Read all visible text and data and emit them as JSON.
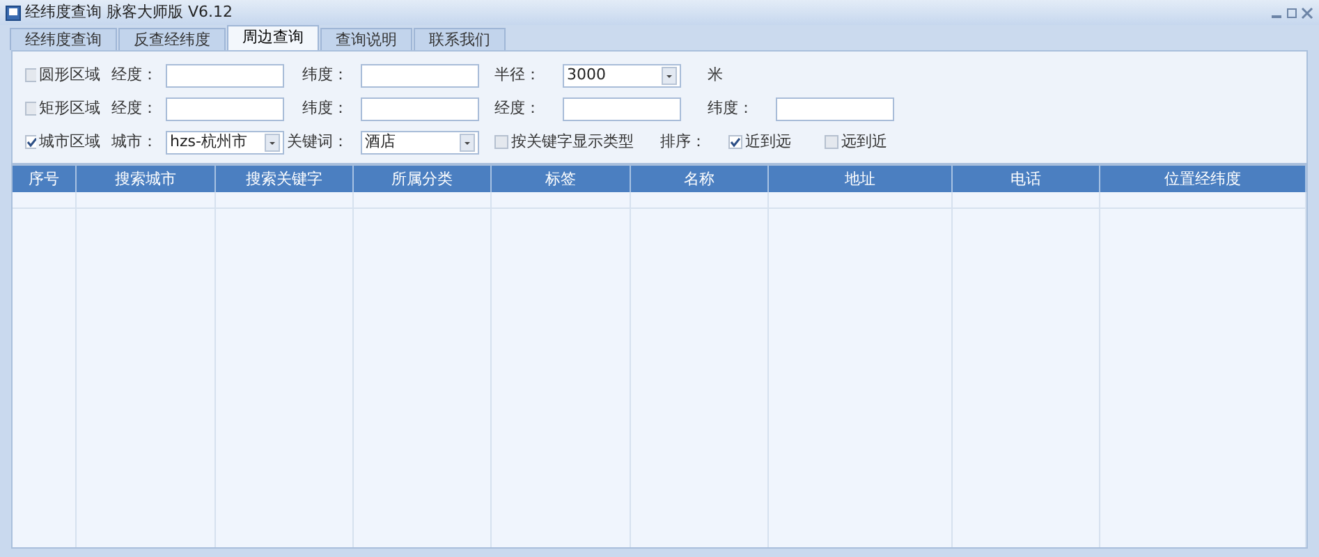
{
  "window": {
    "title": "经纬度查询 脉客大师版 V6.12"
  },
  "tabs": [
    {
      "label": "经纬度查询",
      "selected": false
    },
    {
      "label": "反查经纬度",
      "selected": false
    },
    {
      "label": "周边查询",
      "selected": true
    },
    {
      "label": "查询说明",
      "selected": false
    },
    {
      "label": "联系我们",
      "selected": false
    }
  ],
  "filter_rows": [
    {
      "items": [
        {
          "kind": "checkbox",
          "label": "圆形区域",
          "checked": false
        },
        {
          "kind": "label",
          "text": "经度："
        },
        {
          "kind": "field",
          "value": ""
        },
        {
          "kind": "label",
          "text": "纬度："
        },
        {
          "kind": "field",
          "value": ""
        },
        {
          "kind": "label",
          "text": "半径："
        },
        {
          "kind": "select",
          "value": "3000"
        },
        {
          "kind": "label",
          "text": "米"
        }
      ]
    },
    {
      "items": [
        {
          "kind": "checkbox",
          "label": "矩形区域",
          "checked": false
        },
        {
          "kind": "label",
          "text": "经度："
        },
        {
          "kind": "field",
          "value": ""
        },
        {
          "kind": "label",
          "text": "纬度："
        },
        {
          "kind": "field",
          "value": ""
        },
        {
          "kind": "label",
          "text": "经度："
        },
        {
          "kind": "field",
          "value": ""
        },
        {
          "kind": "label",
          "text": "纬度："
        },
        {
          "kind": "field",
          "value": ""
        }
      ]
    },
    {
      "items": [
        {
          "kind": "checkbox",
          "label": "城市区域",
          "checked": true
        },
        {
          "kind": "label",
          "text": "城市："
        },
        {
          "kind": "select",
          "value": "hzs-杭州市"
        },
        {
          "kind": "label",
          "text": "关键词："
        },
        {
          "kind": "select",
          "value": "酒店"
        },
        {
          "kind": "checkbox",
          "label": "按关键字显示类型",
          "checked": false
        },
        {
          "kind": "label",
          "text": "排序："
        },
        {
          "kind": "checkbox",
          "label": "近到远",
          "checked": true
        },
        {
          "kind": "checkbox",
          "label": "远到近",
          "checked": false
        }
      ]
    }
  ],
  "table": {
    "columns": [
      "序号",
      "搜索城市",
      "搜索关键字",
      "所属分类",
      "标签",
      "名称",
      "地址",
      "电话",
      "位置经纬度"
    ]
  }
}
